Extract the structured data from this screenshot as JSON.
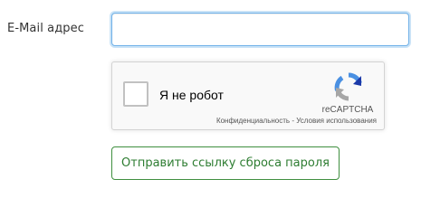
{
  "form": {
    "email_label": "E-Mail адрес",
    "email_value": "",
    "email_placeholder": "",
    "submit_label": "Отправить ссылку сброса пароля"
  },
  "recaptcha": {
    "checkbox_label": "Я не робот",
    "checked": false,
    "brand": "reCAPTCHA",
    "privacy_link": "Конфиденциальность",
    "separator": " - ",
    "terms_link": "Условия использования",
    "logo_icon": "recaptcha-logo-icon"
  },
  "colors": {
    "input_focus_border": "#6fb1e8",
    "button_border": "#3f8f3f",
    "button_text": "#2e7d32",
    "recaptcha_bg": "#f9f9f9"
  }
}
